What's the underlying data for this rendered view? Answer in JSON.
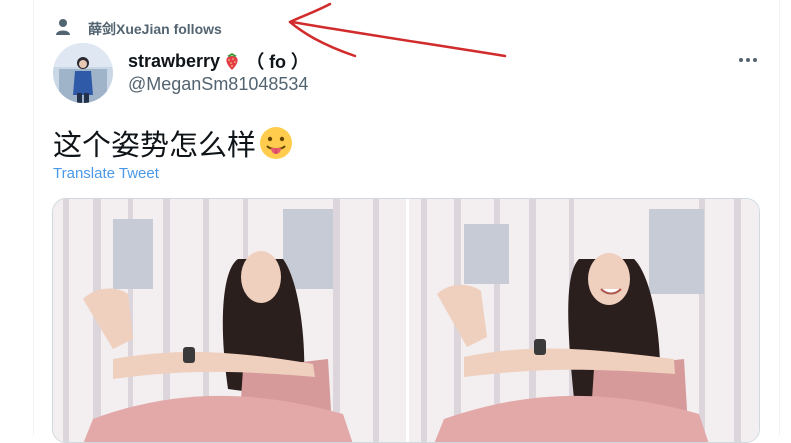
{
  "social_context": {
    "text": "薛剑XueJian follows",
    "icon": "person-icon"
  },
  "author": {
    "display_name": "strawberry",
    "name_emoji": "strawberry-emoji",
    "name_suffix": "（ fo ）",
    "handle": "@MeganSm81048534",
    "avatar": "avatar-photo"
  },
  "tweet": {
    "text": "这个姿势怎么样",
    "text_emoji": "tongue-out-face-emoji",
    "translate_label": "Translate Tweet"
  },
  "media": {
    "count": 2,
    "photos": [
      "yoga-stretch-photo",
      "yoga-stretch-photo-smiling"
    ]
  },
  "menu": {
    "icon": "more-dots-icon"
  },
  "colors": {
    "secondary_text": "#536471",
    "link": "#4a99e9",
    "annotation_arrow": "#d22b2b",
    "border": "#cfd9de"
  }
}
